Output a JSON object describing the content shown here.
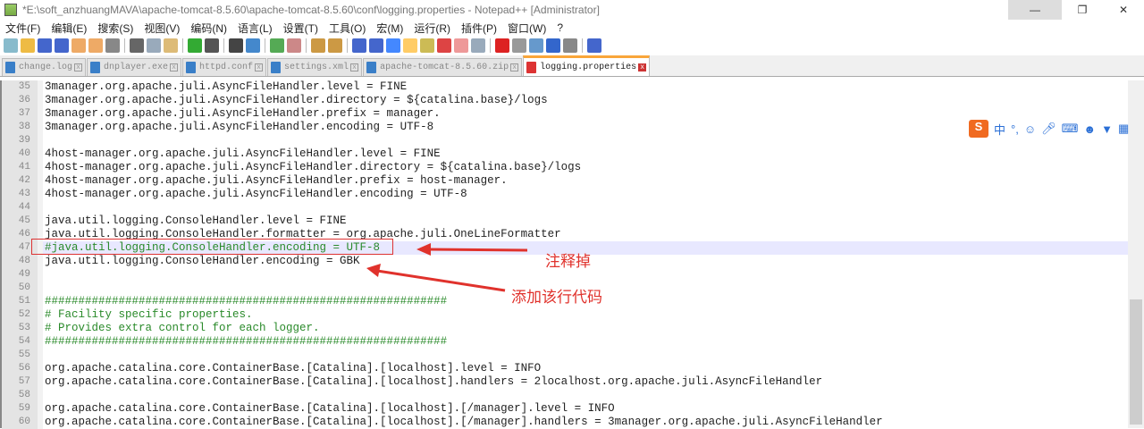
{
  "window": {
    "title": "*E:\\soft_anzhuangMAVA\\apache-tomcat-8.5.60\\apache-tomcat-8.5.60\\conf\\logging.properties - Notepad++ [Administrator]"
  },
  "menu": [
    "文件(F)",
    "编辑(E)",
    "搜索(S)",
    "视图(V)",
    "编码(N)",
    "语言(L)",
    "设置(T)",
    "工具(O)",
    "宏(M)",
    "运行(R)",
    "插件(P)",
    "窗口(W)",
    "?"
  ],
  "tabs": [
    "change.log",
    "dnplayer.exe",
    "httpd.conf",
    "settings.xml",
    "apache-tomcat-8.5.60.zip",
    "logging.properties"
  ],
  "lines": [
    {
      "n": "35",
      "t": "3manager.org.apache.juli.AsyncFileHandler.level = FINE"
    },
    {
      "n": "36",
      "t": "3manager.org.apache.juli.AsyncFileHandler.directory = ${catalina.base}/logs"
    },
    {
      "n": "37",
      "t": "3manager.org.apache.juli.AsyncFileHandler.prefix = manager."
    },
    {
      "n": "38",
      "t": "3manager.org.apache.juli.AsyncFileHandler.encoding = UTF-8"
    },
    {
      "n": "39",
      "t": ""
    },
    {
      "n": "40",
      "t": "4host-manager.org.apache.juli.AsyncFileHandler.level = FINE"
    },
    {
      "n": "41",
      "t": "4host-manager.org.apache.juli.AsyncFileHandler.directory = ${catalina.base}/logs"
    },
    {
      "n": "42",
      "t": "4host-manager.org.apache.juli.AsyncFileHandler.prefix = host-manager."
    },
    {
      "n": "43",
      "t": "4host-manager.org.apache.juli.AsyncFileHandler.encoding = UTF-8"
    },
    {
      "n": "44",
      "t": ""
    },
    {
      "n": "45",
      "t": "java.util.logging.ConsoleHandler.level = FINE"
    },
    {
      "n": "46",
      "t": "java.util.logging.ConsoleHandler.formatter = org.apache.juli.OneLineFormatter"
    },
    {
      "n": "47",
      "t": "#java.util.logging.ConsoleHandler.encoding = UTF-8"
    },
    {
      "n": "48",
      "t": "java.util.logging.ConsoleHandler.encoding = GBK"
    },
    {
      "n": "49",
      "t": ""
    },
    {
      "n": "50",
      "t": ""
    },
    {
      "n": "51",
      "t": "############################################################"
    },
    {
      "n": "52",
      "t": "# Facility specific properties."
    },
    {
      "n": "53",
      "t": "# Provides extra control for each logger."
    },
    {
      "n": "54",
      "t": "############################################################"
    },
    {
      "n": "55",
      "t": ""
    },
    {
      "n": "56",
      "t": "org.apache.catalina.core.ContainerBase.[Catalina].[localhost].level = INFO"
    },
    {
      "n": "57",
      "t": "org.apache.catalina.core.ContainerBase.[Catalina].[localhost].handlers = 2localhost.org.apache.juli.AsyncFileHandler"
    },
    {
      "n": "58",
      "t": ""
    },
    {
      "n": "59",
      "t": "org.apache.catalina.core.ContainerBase.[Catalina].[localhost].[/manager].level = INFO"
    },
    {
      "n": "60",
      "t": "org.apache.catalina.core.ContainerBase.[Catalina].[localhost].[/manager].handlers = 3manager.org.apache.juli.AsyncFileHandler"
    }
  ],
  "annotations": {
    "comment_out": "注释掉",
    "add_line": "添加该行代码"
  },
  "ime": {
    "logo": "S",
    "mode": "中",
    "punct": "°,"
  }
}
